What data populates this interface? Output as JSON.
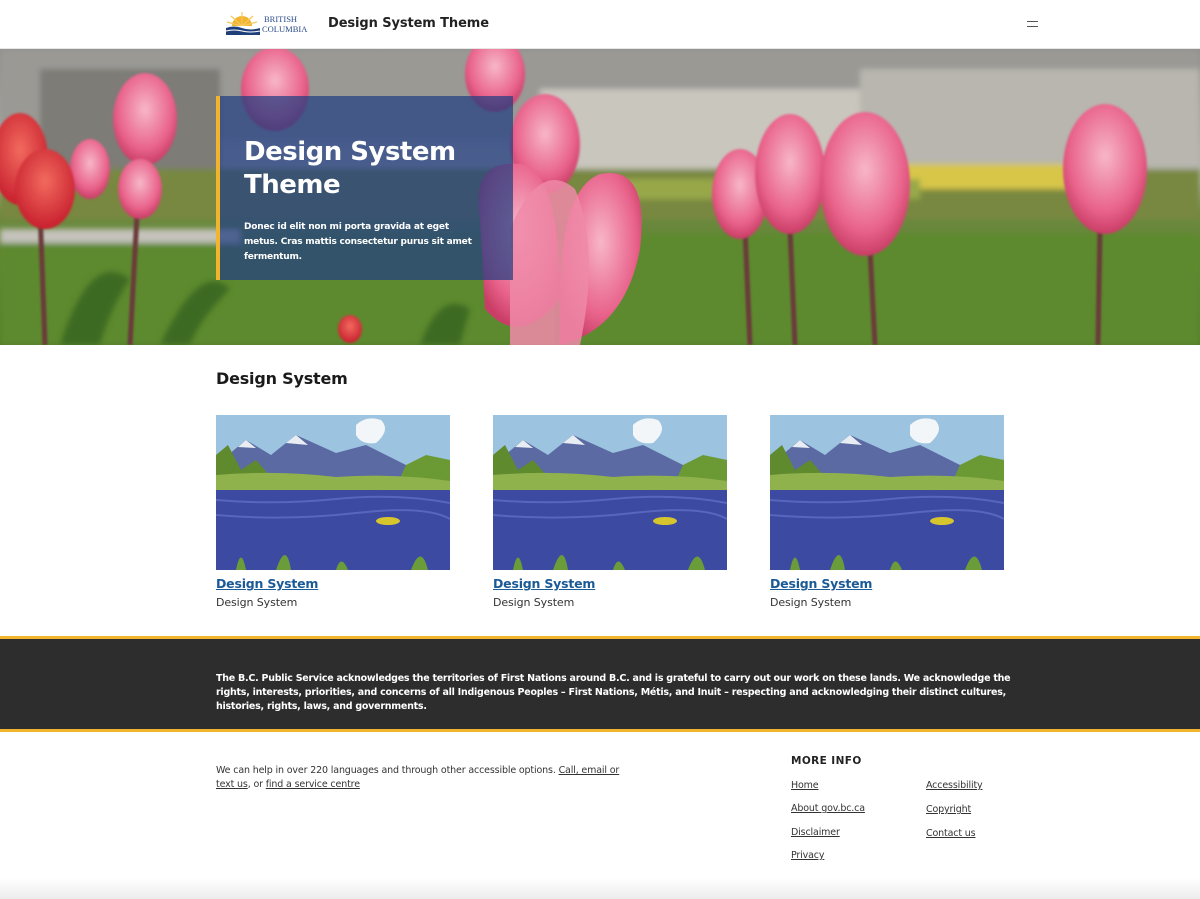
{
  "header": {
    "logo_alt": "British Columbia",
    "logo_line1": "BRITISH",
    "logo_line2": "COLUMBIA",
    "site_title": "Design System Theme",
    "menu_icon": "hamburger-menu-icon"
  },
  "hero": {
    "title": "Design System Theme",
    "text": "Donec id elit non mi porta gravida at eget metus. Cras mattis consectetur purus sit amet fermentum.",
    "image": "pink-tulips-photo"
  },
  "section": {
    "heading": "Design System",
    "cards": [
      {
        "link": "Design System",
        "description": "Design System",
        "image": "river-mountain-photo"
      },
      {
        "link": "Design System",
        "description": "Design System",
        "image": "river-mountain-photo"
      },
      {
        "link": "Design System",
        "description": "Design System",
        "image": "river-mountain-photo"
      }
    ]
  },
  "acknowledgement": {
    "text": "The B.C. Public Service acknowledges the territories of First Nations around B.C. and is grateful to carry out our work on these lands. We acknowledge the rights, interests, priorities, and concerns of all Indigenous Peoples – First Nations, Métis, and Inuit – respecting and acknowledging their distinct cultures, histories, rights, laws, and governments."
  },
  "footer": {
    "help_text_before": "We can help in over 220 languages and through other accessible options. ",
    "help_link1": "Call, email or text us",
    "help_text_middle": ", or ",
    "help_link2": "find a service centre",
    "more_info_heading": "MORE INFO",
    "links": [
      "Home",
      "About gov.bc.ca",
      "Disclaimer",
      "Privacy",
      "Accessibility",
      "Copyright",
      "Contact us"
    ]
  },
  "colors": {
    "accent_gold": "#f2b32d",
    "link_blue": "#1a5a96",
    "band_dark": "#2d2d2d",
    "hero_card": "#213e82"
  }
}
